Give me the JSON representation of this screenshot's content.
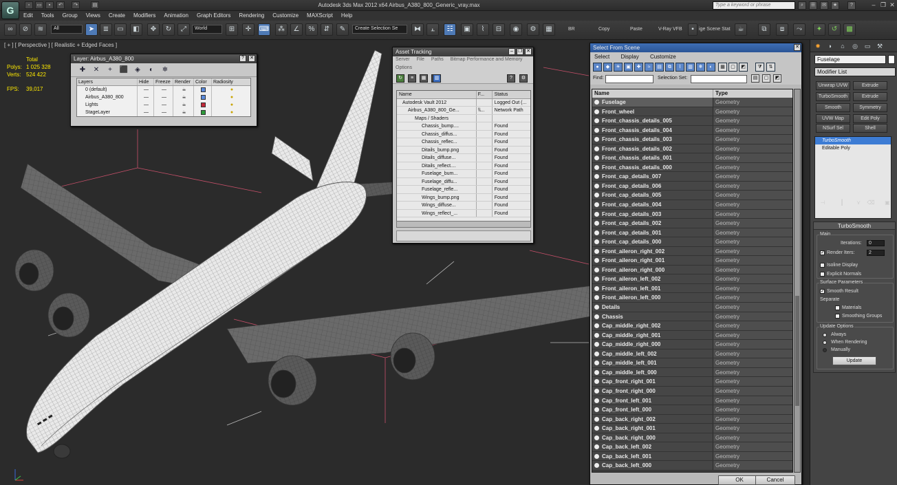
{
  "app": {
    "title": "Autodesk 3ds Max  2012 x64      Airbus_A380_800_Generic_vray.max",
    "logo": "3ds-max-logo",
    "search_placeholder": "Type a keyword or phrase"
  },
  "menu": [
    "Edit",
    "Tools",
    "Group",
    "Views",
    "Create",
    "Modifiers",
    "Animation",
    "Graph Editors",
    "Rendering",
    "Customize",
    "MAXScript",
    "Help"
  ],
  "toolbar": {
    "selection_filter": "All",
    "coord_system": "World",
    "named_selection": "Create Selection Se",
    "labels": [
      "BR",
      "Copy",
      "Paste",
      "V-Ray VFB",
      "ige Scene Stat"
    ]
  },
  "viewport": {
    "label": "[ + ] [ Perspective ] [ Realistic + Edged Faces ]",
    "stats": {
      "header": "Total",
      "polys_label": "Polys:",
      "polys_value": "1 025 328",
      "verts_label": "Verts:",
      "verts_value": "524 422",
      "fps_label": "FPS:",
      "fps_value": "39,017"
    },
    "colors": {
      "background": "#2b2b2b",
      "stats": "#ffea00",
      "mesh": "#e8e8e8",
      "grid": "#c8506a"
    }
  },
  "layer_manager": {
    "title": "Layer: Airbus_A380_800",
    "headers": [
      "Layers",
      "Hide",
      "Freeze",
      "Render",
      "Color",
      "Radiosity"
    ],
    "rows": [
      {
        "name": "0 (default)",
        "color": "#5a8adc"
      },
      {
        "name": "Airbus_A380_800",
        "color": "#5a8adc"
      },
      {
        "name": "Lights",
        "color": "#c02838"
      },
      {
        "name": "StageLayer",
        "color": "#2e9a3a"
      }
    ]
  },
  "asset_tracking": {
    "title": "Asset Tracking",
    "menu": [
      "Server",
      "File",
      "Paths",
      "Bitmap Performance and Memory",
      "Options"
    ],
    "headers": [
      "Name",
      "F...",
      "Status"
    ],
    "rows": [
      {
        "name": "Autodesk Vault 2012",
        "f": "",
        "status": "Logged Out (..."
      },
      {
        "name": "Airbus_A380_800_Ge...",
        "f": "\\\\...",
        "status": "Network Path"
      },
      {
        "name": "Maps / Shaders",
        "f": "",
        "status": ""
      },
      {
        "name": "Chassis_bump....",
        "f": "",
        "status": "Found"
      },
      {
        "name": "Chassis_diffus...",
        "f": "",
        "status": "Found"
      },
      {
        "name": "Chassis_reflec...",
        "f": "",
        "status": "Found"
      },
      {
        "name": "Ditails_bump.png",
        "f": "",
        "status": "Found"
      },
      {
        "name": "Ditails_diffuse...",
        "f": "",
        "status": "Found"
      },
      {
        "name": "Ditails_reflect....",
        "f": "",
        "status": "Found"
      },
      {
        "name": "Fuselage_bum...",
        "f": "",
        "status": "Found"
      },
      {
        "name": "Fuselage_diffu...",
        "f": "",
        "status": "Found"
      },
      {
        "name": "Fuselage_refle...",
        "f": "",
        "status": "Found"
      },
      {
        "name": "Wings_bump.png",
        "f": "",
        "status": "Found"
      },
      {
        "name": "Wings_diffuse...",
        "f": "",
        "status": "Found"
      },
      {
        "name": "Wings_reflect_...",
        "f": "",
        "status": "Found"
      }
    ]
  },
  "select_from_scene": {
    "title": "Select From Scene",
    "menu": [
      "Select",
      "Display",
      "Customize"
    ],
    "find_label": "Find:",
    "selection_set_label": "Selection Set:",
    "headers": [
      "Name",
      "Type"
    ],
    "rows": [
      {
        "name": "Fuselage",
        "type": "Geometry"
      },
      {
        "name": "Front_wheel",
        "type": "Geometry"
      },
      {
        "name": "Front_chassis_details_005",
        "type": "Geometry"
      },
      {
        "name": "Front_chassis_details_004",
        "type": "Geometry"
      },
      {
        "name": "Front_chassis_details_003",
        "type": "Geometry"
      },
      {
        "name": "Front_chassis_details_002",
        "type": "Geometry"
      },
      {
        "name": "Front_chassis_details_001",
        "type": "Geometry"
      },
      {
        "name": "Front_chassis_details_000",
        "type": "Geometry"
      },
      {
        "name": "Front_cap_details_007",
        "type": "Geometry"
      },
      {
        "name": "Front_cap_details_006",
        "type": "Geometry"
      },
      {
        "name": "Front_cap_details_005",
        "type": "Geometry"
      },
      {
        "name": "Front_cap_details_004",
        "type": "Geometry"
      },
      {
        "name": "Front_cap_details_003",
        "type": "Geometry"
      },
      {
        "name": "Front_cap_details_002",
        "type": "Geometry"
      },
      {
        "name": "Front_cap_details_001",
        "type": "Geometry"
      },
      {
        "name": "Front_cap_details_000",
        "type": "Geometry"
      },
      {
        "name": "Front_aileron_right_002",
        "type": "Geometry"
      },
      {
        "name": "Front_aileron_right_001",
        "type": "Geometry"
      },
      {
        "name": "Front_aileron_right_000",
        "type": "Geometry"
      },
      {
        "name": "Front_aileron_left_002",
        "type": "Geometry"
      },
      {
        "name": "Front_aileron_left_001",
        "type": "Geometry"
      },
      {
        "name": "Front_aileron_left_000",
        "type": "Geometry"
      },
      {
        "name": "Details",
        "type": "Geometry"
      },
      {
        "name": "Chassis",
        "type": "Geometry"
      },
      {
        "name": "Cap_middle_right_002",
        "type": "Geometry"
      },
      {
        "name": "Cap_middle_right_001",
        "type": "Geometry"
      },
      {
        "name": "Cap_middle_right_000",
        "type": "Geometry"
      },
      {
        "name": "Cap_middle_left_002",
        "type": "Geometry"
      },
      {
        "name": "Cap_middle_left_001",
        "type": "Geometry"
      },
      {
        "name": "Cap_middle_left_000",
        "type": "Geometry"
      },
      {
        "name": "Cap_front_right_001",
        "type": "Geometry"
      },
      {
        "name": "Cap_front_right_000",
        "type": "Geometry"
      },
      {
        "name": "Cap_front_left_001",
        "type": "Geometry"
      },
      {
        "name": "Cap_front_left_000",
        "type": "Geometry"
      },
      {
        "name": "Cap_back_right_002",
        "type": "Geometry"
      },
      {
        "name": "Cap_back_right_001",
        "type": "Geometry"
      },
      {
        "name": "Cap_back_right_000",
        "type": "Geometry"
      },
      {
        "name": "Cap_back_left_002",
        "type": "Geometry"
      },
      {
        "name": "Cap_back_left_001",
        "type": "Geometry"
      },
      {
        "name": "Cap_back_left_000",
        "type": "Geometry"
      }
    ],
    "ok_label": "OK",
    "cancel_label": "Cancel"
  },
  "command_panel": {
    "object_name": "Fuselage",
    "modifier_list": "Modifier List",
    "buttons": [
      "Unwrap UVW",
      "Extrude",
      "TurboSmooth",
      "Extrude",
      "Smooth",
      "Symmetry",
      "UVW Map",
      "Edit Poly",
      "NSurf Sel",
      "Shell"
    ],
    "stack": [
      "TurboSmooth",
      "Editable Poly"
    ],
    "rollout": {
      "title": "TurboSmooth",
      "main_group": "Main",
      "iterations_label": "Iterations:",
      "iterations_value": "0",
      "render_iters_label": "Render Iters:",
      "render_iters_value": "2",
      "isoline": "Isoline Display",
      "explicit_normals": "Explicit Normals",
      "surface_group": "Surface Parameters",
      "smooth_result": "Smooth Result",
      "separate_label": "Separate",
      "materials": "Materials",
      "smoothing_groups": "Smoothing Groups",
      "update_group": "Update Options",
      "always": "Always",
      "when_rendering": "When Rendering",
      "manually": "Manually",
      "update_button": "Update"
    }
  }
}
